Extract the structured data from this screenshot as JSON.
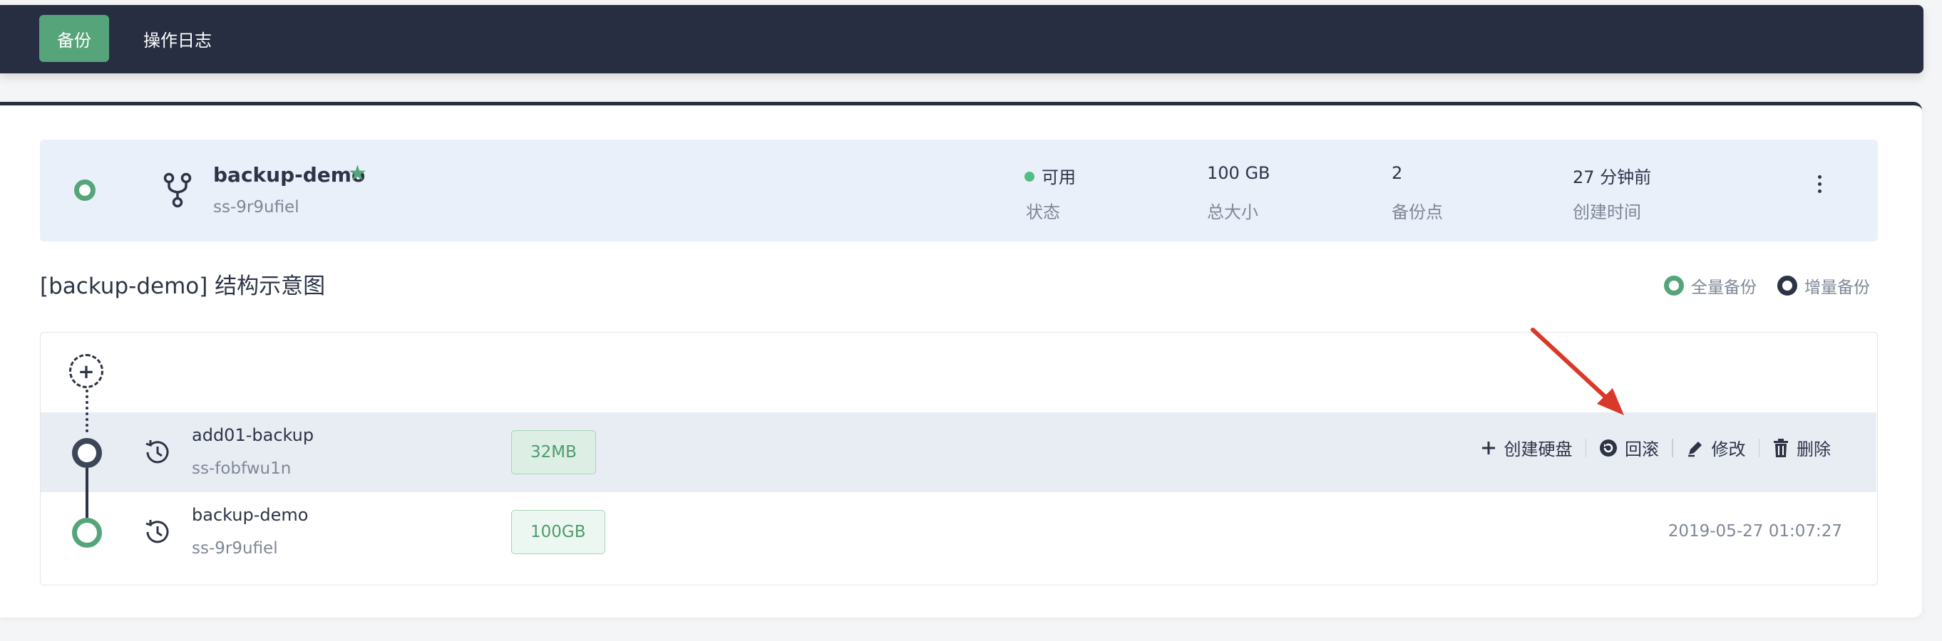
{
  "nav": {
    "tabs": [
      {
        "label": "备份",
        "active": true
      },
      {
        "label": "操作日志",
        "active": false
      }
    ]
  },
  "summary": {
    "name": "backup-demo",
    "id": "ss-9r9ufiel",
    "starred": true,
    "stats": [
      {
        "value": "可用",
        "label": "状态"
      },
      {
        "value": "100 GB",
        "label": "总大小"
      },
      {
        "value": "2",
        "label": "备份点"
      },
      {
        "value": "27 分钟前",
        "label": "创建时间"
      }
    ]
  },
  "structure": {
    "title": "[backup-demo] 结构示意图",
    "legend": {
      "full": "全量备份",
      "incremental": "增量备份"
    },
    "rows": [
      {
        "name": "add01-backup",
        "id": "ss-fobfwu1n",
        "size": "32MB",
        "type": "incremental",
        "actions": {
          "create_disk": "创建硬盘",
          "rollback": "回滚",
          "edit": "修改",
          "delete": "删除"
        }
      },
      {
        "name": "backup-demo",
        "id": "ss-9r9ufiel",
        "size": "100GB",
        "type": "full",
        "timestamp": "2019-05-27 01:07:27"
      }
    ]
  },
  "colors": {
    "nav_bg": "#272e42",
    "accent_green": "#56a57a",
    "status_available": "#4fbf82",
    "annotation_arrow": "#d9392b"
  },
  "icons": {
    "branch": "fork-branch-icon",
    "history": "history-clock-icon",
    "create_disk": "plus-icon",
    "rollback": "rollback-icon",
    "edit": "pencil-icon",
    "delete": "trash-icon"
  }
}
